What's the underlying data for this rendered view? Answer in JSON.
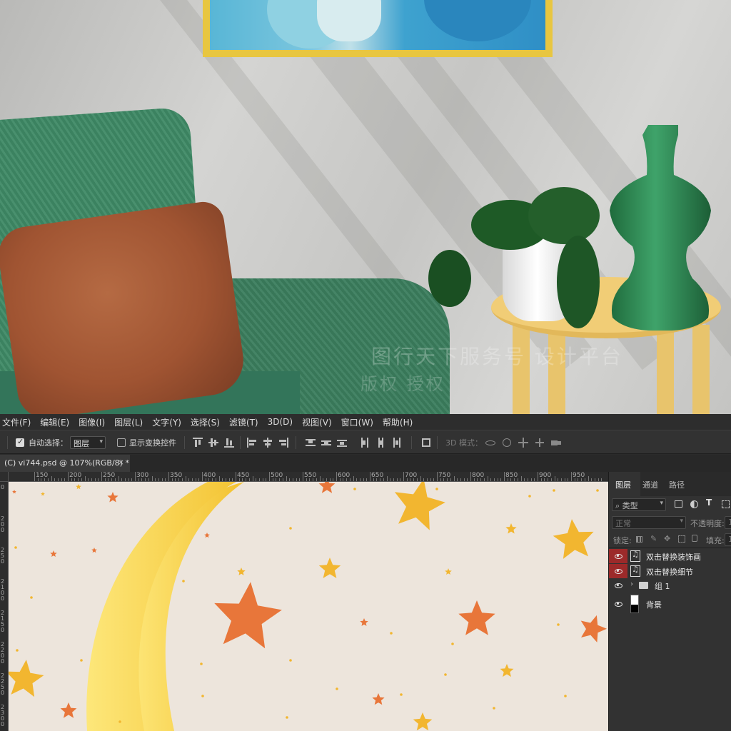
{
  "menu": {
    "items": [
      "文件(F)",
      "编辑(E)",
      "图像(I)",
      "图层(L)",
      "文字(Y)",
      "选择(S)",
      "滤镜(T)",
      "3D(D)",
      "视图(V)",
      "窗口(W)",
      "帮助(H)"
    ]
  },
  "options": {
    "auto_select_label": "自动选择：",
    "auto_select_checked": true,
    "auto_select_value": "图层",
    "show_transform_label": "显示变换控件",
    "show_transform_checked": false,
    "mode_3d_label": "3D 模式："
  },
  "document": {
    "tab_title": "(C) vi744.psd @ 107%(RGB/8) *",
    "close_symbol": "×"
  },
  "ruler": {
    "h_labels": [
      "150",
      "200",
      "250",
      "300",
      "350",
      "400",
      "450",
      "500",
      "550",
      "600",
      "650",
      "700",
      "750",
      "800",
      "850",
      "900",
      "950"
    ],
    "v_labels": [
      "0",
      "200",
      "250",
      "2100",
      "2150",
      "2200",
      "2250",
      "2300"
    ]
  },
  "layers_panel": {
    "tabs": [
      "图层",
      "通道",
      "路径"
    ],
    "active_tab": "图层",
    "filter_label": "类型",
    "blend_mode": "正常",
    "opacity_label": "不透明度:",
    "opacity_value": "1",
    "lock_label": "锁定:",
    "fill_label": "填充:",
    "fill_value": "1",
    "layers": [
      {
        "name": "双击替换装饰画",
        "type": "smart-object",
        "visible": true,
        "highlighted": true
      },
      {
        "name": "双击替换细节",
        "type": "smart-object",
        "visible": true,
        "highlighted": true
      },
      {
        "name": "组 1",
        "type": "group",
        "visible": true,
        "highlighted": false
      },
      {
        "name": "背景",
        "type": "pixel",
        "visible": true,
        "highlighted": false
      }
    ]
  },
  "watermark": {
    "line1": "图行天下服务号 设计平台",
    "line2": "版权 授权"
  },
  "colors": {
    "canvas_bg": "#ede5dc",
    "moon": "#f6d24a",
    "star_gold": "#f2b630",
    "star_orange": "#e8763a",
    "layer_eye_highlight": "#9c2a2a",
    "chair_green": "#3f8a66",
    "pillow_brown": "#a05432",
    "frame_gold": "#e8c640"
  }
}
